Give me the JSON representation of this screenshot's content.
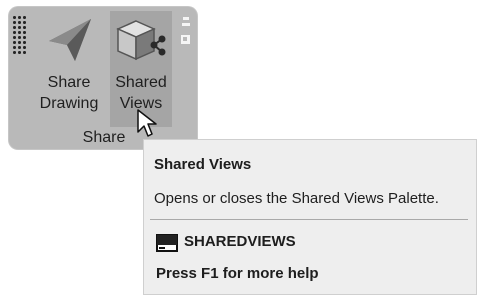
{
  "ribbon": {
    "panel_title": "Share",
    "buttons": [
      {
        "label_line1": "Share",
        "label_line2": "Drawing",
        "icon": "paper-plane-icon"
      },
      {
        "label_line1": "Shared",
        "label_line2": "Views",
        "icon": "cube-share-icon"
      }
    ]
  },
  "tooltip": {
    "title": "Shared Views",
    "description": "Opens or closes the Shared Views Palette.",
    "command": "SHAREDVIEWS",
    "command_icon": "command-line-icon",
    "help": "Press F1 for more help"
  },
  "colors": {
    "panel_bg": "#b9b9b9",
    "button_hover_bg": "#a5a5a5",
    "tooltip_bg": "#eeeeee"
  }
}
